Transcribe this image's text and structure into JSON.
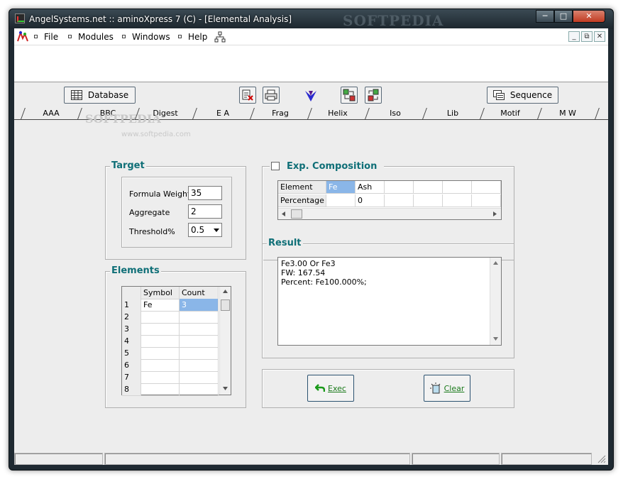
{
  "window": {
    "title": "AngelSystems.net :: aminoXpress 7 (C) - [Elemental Analysis]",
    "watermark": "SOFTPEDIA"
  },
  "window_controls": {
    "minimize": "─",
    "maximize": "□",
    "close": "✕"
  },
  "menu": {
    "items": [
      {
        "label": "File"
      },
      {
        "label": "Modules"
      },
      {
        "label": "Windows"
      },
      {
        "label": "Help"
      }
    ]
  },
  "mdi_controls": {
    "minimize": "_",
    "restore": "⧉",
    "close": "✕"
  },
  "toolbar": {
    "database_label": "Database",
    "sequence_label": "Sequence"
  },
  "tabs": [
    {
      "label": "AAA"
    },
    {
      "label": "BBC"
    },
    {
      "label": "Digest"
    },
    {
      "label": "E A"
    },
    {
      "label": "Frag"
    },
    {
      "label": "Helix"
    },
    {
      "label": "Iso"
    },
    {
      "label": "Lib"
    },
    {
      "label": "Motif"
    },
    {
      "label": "M W"
    }
  ],
  "active_tab": "E A",
  "watermarks": {
    "logo": "SOFTPEDIA",
    "url": "www.softpedia.com"
  },
  "target": {
    "title": "Target",
    "formula_weight_label": "Formula Weight",
    "formula_weight_value": "35",
    "aggregate_label": "Aggregate",
    "aggregate_value": "2",
    "threshold_label": "Threshold%",
    "threshold_value": "0.5"
  },
  "elements": {
    "title": "Elements",
    "columns": [
      "Symbol",
      "Count"
    ],
    "rows": [
      {
        "num": "1",
        "symbol": "Fe",
        "count": "3"
      },
      {
        "num": "2",
        "symbol": "",
        "count": ""
      },
      {
        "num": "3",
        "symbol": "",
        "count": ""
      },
      {
        "num": "4",
        "symbol": "",
        "count": ""
      },
      {
        "num": "5",
        "symbol": "",
        "count": ""
      },
      {
        "num": "6",
        "symbol": "",
        "count": ""
      },
      {
        "num": "7",
        "symbol": "",
        "count": ""
      },
      {
        "num": "8",
        "symbol": "",
        "count": ""
      }
    ]
  },
  "exp_composition": {
    "title": "Exp. Composition",
    "checked": false,
    "row_labels": [
      "Element",
      "Percentage"
    ],
    "element_values": [
      "Fe",
      "Ash",
      "",
      "",
      "",
      ""
    ],
    "percentage_values": [
      "",
      "0",
      "",
      "",
      "",
      ""
    ]
  },
  "result": {
    "title": "Result",
    "lines": [
      "Fe3.00 Or Fe3",
      "FW:     167.54",
      "Percent: Fe100.000%;"
    ]
  },
  "actions": {
    "exec_label": "Exec",
    "clear_label": "Clear"
  }
}
